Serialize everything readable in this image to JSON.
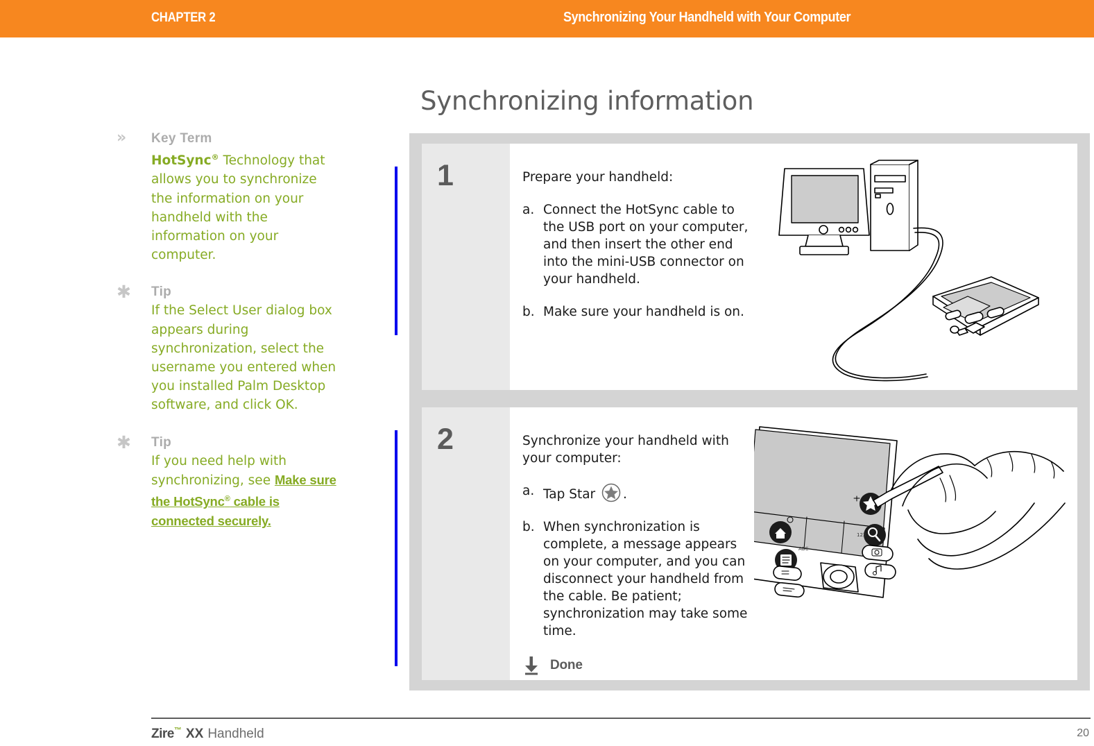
{
  "header": {
    "chapter_label": "CHAPTER 2",
    "chapter_title": "Synchronizing Your Handheld with Your Computer",
    "bar_color": "#f7871f"
  },
  "page": {
    "heading": "Synchronizing information",
    "accent_green": "#86ab24",
    "progress_bar_color": "#0000ee",
    "panel_gray": "#d4d4d4",
    "number_col_gray": "#e9e9e9"
  },
  "sidebar": {
    "notes": [
      {
        "icon": "double-chevron-right-icon",
        "icon_glyph": "»",
        "heading": "Key Term",
        "term": "HotSync",
        "term_sup": "®",
        "body": " Technology that allows you to synchronize the information on your handheld with the information on your computer."
      },
      {
        "icon": "asterisk-icon",
        "icon_glyph": "✱",
        "heading": "Tip",
        "body": "If the Select User dialog box appears during synchronization, select the username you entered when you installed Palm Desktop software, and click OK."
      },
      {
        "icon": "asterisk-icon",
        "icon_glyph": "✱",
        "heading": "Tip",
        "body_lead": "If you need help with synchronizing, see ",
        "link_part_1": "Make sure the HotSync",
        "link_sup": "®",
        "link_part_2": " cable is connected securely."
      }
    ]
  },
  "steps": [
    {
      "number": "1",
      "intro": "Prepare your handheld:",
      "substeps": [
        {
          "marker": "a.",
          "text": "Connect the HotSync cable to the USB port on your computer, and then insert the other end into the mini-USB connector on your handheld."
        },
        {
          "marker": "b.",
          "text": "Make sure your handheld is on."
        }
      ],
      "figure_name": "computer-cable-handheld-illustration"
    },
    {
      "number": "2",
      "intro": "Synchronize your handheld with your computer:",
      "substeps": [
        {
          "marker": "a.",
          "text_before": " Tap Star ",
          "inline_icon": "star-in-circle-icon",
          "text_after": "."
        },
        {
          "marker": "b.",
          "text": "When synchronization is complete, a message appears on your computer, and you can disconnect your handheld from the cable. Be patient; synchronization may take some time."
        }
      ],
      "done_icon": "down-arrow-icon",
      "done_label": "Done",
      "figure_name": "hand-stylus-tapping-star-illustration"
    }
  ],
  "footer": {
    "product": "Zire",
    "trademark": "™",
    "model": "XX",
    "category": "Handheld",
    "page_number": "20"
  }
}
